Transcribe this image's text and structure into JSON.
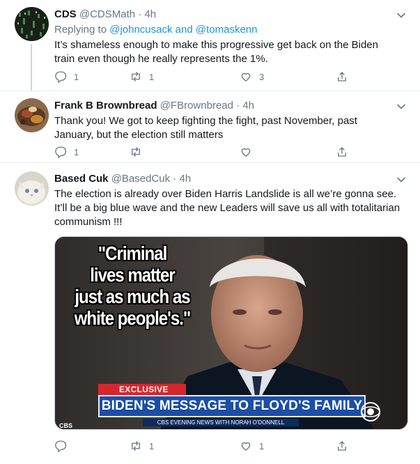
{
  "tweets": [
    {
      "name": "CDS",
      "handle": "@CDSMath",
      "time": "4h",
      "reply_prefix": "Replying to",
      "reply_user_1": "@johncusack",
      "reply_and": "and",
      "reply_user_2": "@tomaskenn",
      "text_line_1": "It’s shameless enough to make this progressive get back on the Biden",
      "text_line_2": "train even though he really represents the 1%.",
      "replies": "1",
      "retweets": "1",
      "likes": "3"
    },
    {
      "name": "Frank B Brownbread",
      "handle": "@FBrownbread",
      "time": "4h",
      "text_line_1": "Thank you! We got to keep fighting the fight, past November, past",
      "text_line_2": "January, but the election still matters",
      "replies": "1",
      "retweets": "",
      "likes": ""
    },
    {
      "name": "Based Cuk",
      "handle": "@BasedCuk",
      "time": "4h",
      "text_line_1": "The election is already over Biden Harris Landslide is all we’re gonna see.",
      "text_line_2": "It’ll be a big blue wave and the new Leaders will save us all with totalitarian",
      "text_line_3": "communism !!!",
      "replies": "",
      "retweets": "1",
      "likes": "1"
    }
  ],
  "media": {
    "quote_line_1": "\"Criminal",
    "quote_line_2": "lives matter",
    "quote_line_3": "just as much as",
    "quote_line_4": "white people's.\"",
    "exclusive_label": "EXCLUSIVE",
    "headline": "BIDEN'S MESSAGE TO FLOYD'S FAMILY",
    "newsbar": "CBS EVENING NEWS  WITH NORAH O'DONNELL",
    "corner_logo": "CBS"
  },
  "separator": "·",
  "colors": {
    "text": "#14171a",
    "secondary": "#657786",
    "link": "#1b95e0",
    "thread_line": "#ccd6dd",
    "headline_blue": "#1c4ea6",
    "exclusive_red": "#d6262d"
  },
  "icons": [
    "reply-icon",
    "retweet-icon",
    "like-icon",
    "share-icon",
    "chevron-down-icon"
  ]
}
